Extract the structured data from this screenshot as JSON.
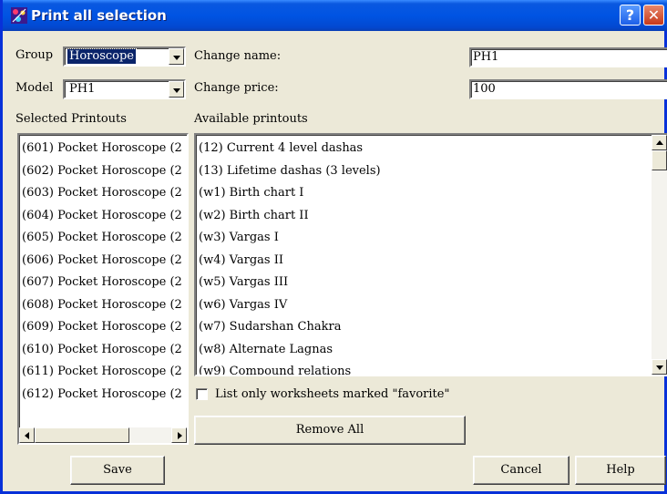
{
  "window": {
    "title": "Print all selection",
    "help_glyph": "?",
    "close_glyph": "✕"
  },
  "form": {
    "group_label": "Group",
    "group_value": "Horoscope",
    "model_label": "Model",
    "model_value": "PH1",
    "change_name_label": "Change name:",
    "change_name_value": "PH1",
    "change_price_label": "Change price:",
    "change_price_value": "100"
  },
  "selected": {
    "header": "Selected Printouts",
    "items": [
      "(601) Pocket Horoscope (2",
      "(602) Pocket Horoscope (2",
      "(603) Pocket Horoscope (2",
      "(604) Pocket Horoscope (2",
      "(605) Pocket Horoscope (2",
      "(606) Pocket Horoscope (2",
      "(607) Pocket Horoscope (2",
      "(608) Pocket Horoscope (2",
      "(609) Pocket Horoscope (2",
      "(610) Pocket Horoscope (2",
      "(611) Pocket Horoscope (2",
      "(612) Pocket Horoscope (2"
    ]
  },
  "available": {
    "header": "Available printouts",
    "items": [
      "(12) Current 4 level dashas",
      "(13) Lifetime dashas (3 levels)",
      "(w1) Birth chart I",
      "(w2) Birth chart II",
      "(w3) Vargas I",
      "(w4) Vargas II",
      "(w5) Vargas III",
      "(w6) Vargas IV",
      "(w7) Sudarshan Chakra",
      "(w8) Alternate Lagnas",
      "(w9) Compound relations"
    ]
  },
  "favorite_checkbox": {
    "label": "List only worksheets marked \"favorite\"",
    "checked": false
  },
  "buttons": {
    "remove_all": "Remove All",
    "save": "Save",
    "cancel": "Cancel",
    "help": "Help"
  },
  "colors": {
    "title_bar": "#0054e3",
    "selection": "#0a246a",
    "face": "#ece9d8"
  }
}
